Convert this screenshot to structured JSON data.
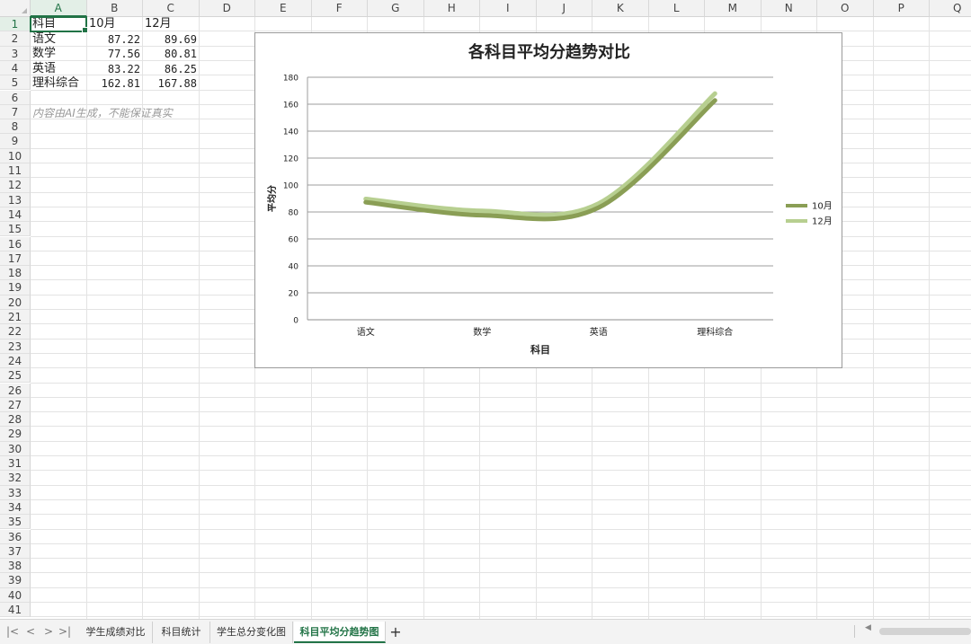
{
  "columns": [
    "A",
    "B",
    "C",
    "D",
    "E",
    "F",
    "G",
    "H",
    "I",
    "J",
    "K",
    "L",
    "M",
    "N",
    "O",
    "P",
    "Q"
  ],
  "rows": [
    "1",
    "2",
    "3",
    "4",
    "5",
    "6",
    "7",
    "8",
    "9",
    "10",
    "11",
    "12",
    "13",
    "14",
    "15",
    "16",
    "17",
    "18",
    "19",
    "20",
    "21",
    "22",
    "23",
    "24",
    "25",
    "26",
    "27",
    "28",
    "29",
    "30",
    "31",
    "32",
    "33",
    "34",
    "35",
    "36",
    "37",
    "38",
    "39",
    "40",
    "41"
  ],
  "table": {
    "header": [
      "科目",
      "10月",
      "12月"
    ],
    "rows": [
      [
        "语文",
        "87.22",
        "89.69"
      ],
      [
        "数学",
        "77.56",
        "80.81"
      ],
      [
        "英语",
        "83.22",
        "86.25"
      ],
      [
        "理科综合",
        "162.81",
        "167.88"
      ]
    ]
  },
  "note": "内容由AI生成，不能保证真实",
  "chart_data": {
    "type": "line",
    "title": "各科目平均分趋势对比",
    "xlabel": "科目",
    "ylabel": "平均分",
    "categories": [
      "语文",
      "数学",
      "英语",
      "理科综合"
    ],
    "series": [
      {
        "name": "10月",
        "values": [
          87.22,
          77.56,
          83.22,
          162.81
        ],
        "color": "#8a9e55"
      },
      {
        "name": "12月",
        "values": [
          89.69,
          80.81,
          86.25,
          167.88
        ],
        "color": "#b7cf90"
      }
    ],
    "ylim": [
      0,
      180
    ],
    "yticks": [
      "0",
      "20",
      "40",
      "60",
      "80",
      "100",
      "120",
      "140",
      "160",
      "180"
    ],
    "smooth": true,
    "grid": "horizontal",
    "legend_position": "right"
  },
  "sheets": [
    "学生成绩对比",
    "科目统计",
    "学生总分变化图",
    "科目平均分趋势图"
  ],
  "active_sheet": 3,
  "add_sheet_label": "+",
  "nav": {
    "first": "|<",
    "prev": "<",
    "next": ">",
    "last": ">|"
  },
  "colors": {
    "accent": "#217346"
  }
}
